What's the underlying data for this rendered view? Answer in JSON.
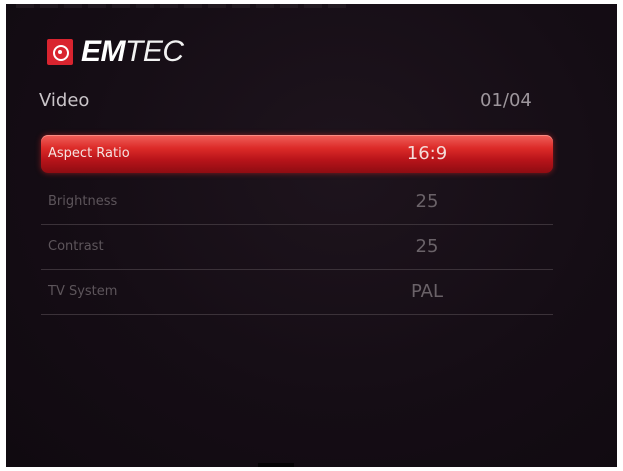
{
  "brand": {
    "logo_em": "EM",
    "logo_tec": "TEC"
  },
  "menu": {
    "title": "Video",
    "page_indicator": "01/04"
  },
  "settings": [
    {
      "label": "Aspect Ratio",
      "value": "16:9",
      "selected": true
    },
    {
      "label": "Brightness",
      "value": "25",
      "selected": false
    },
    {
      "label": "Contrast",
      "value": "25",
      "selected": false
    },
    {
      "label": "TV System",
      "value": "PAL",
      "selected": false
    }
  ],
  "colors": {
    "highlight": "#d3221f",
    "background": "#150d15",
    "logo_red": "#d9242f"
  },
  "icons": {
    "logo": "emtec-logo-icon"
  }
}
